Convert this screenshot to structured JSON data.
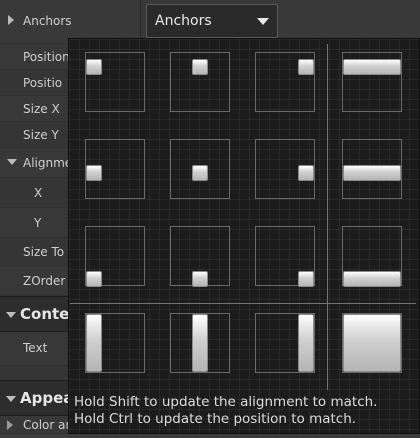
{
  "details": {
    "anchors_label": "Anchors",
    "anchors_value": "Anchors",
    "rows": [
      {
        "label": "Position"
      },
      {
        "label": "Positio"
      },
      {
        "label": "Size X"
      },
      {
        "label": "Size Y"
      },
      {
        "label": "Alignme"
      },
      {
        "label": "X"
      },
      {
        "label": "Y"
      },
      {
        "label": "Size To"
      },
      {
        "label": "ZOrder"
      }
    ],
    "content_section": "Conte",
    "text_label": "Text",
    "appearance_section": "Appea",
    "color_label": "Color an"
  },
  "anchor_popup": {
    "presets": [
      "top-left",
      "top-center",
      "top-right",
      "top-stretch",
      "center-left",
      "center",
      "center-right",
      "center-stretch",
      "bottom-left",
      "bottom-center",
      "bottom-right",
      "bottom-stretch",
      "stretch-left",
      "stretch-center",
      "stretch-right",
      "stretch-full"
    ],
    "hint_line1": "Hold Shift to update the alignment to match.",
    "hint_line2": "Hold Ctrl to update the position to match."
  },
  "colors": {
    "accent": "#2b86d9",
    "panel": "#383838",
    "popup": "#1c1c1c"
  }
}
